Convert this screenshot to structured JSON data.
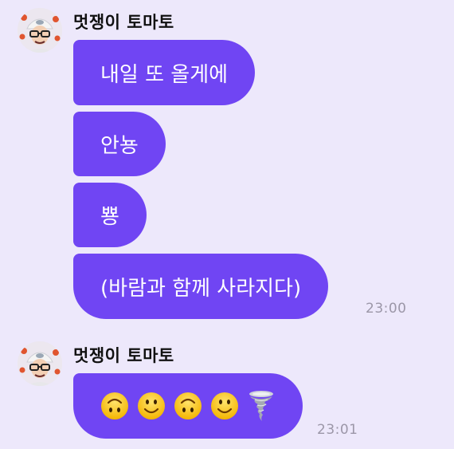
{
  "groups": [
    {
      "sender": "멋쟁이 토마토",
      "messages": [
        "내일 또 올게에",
        "안뇽",
        "뿅",
        "(바람과 함께 사라지다)"
      ],
      "time": "23:00"
    },
    {
      "sender": "멋쟁이 토마토",
      "emojis": [
        "upside-down-face",
        "slightly-smiling-face",
        "upside-down-face",
        "slightly-smiling-face",
        "tornado"
      ],
      "time": "23:01"
    }
  ],
  "colors": {
    "background": "#ede8fb",
    "bubble": "#7045f3",
    "bubble_text": "#ffffff",
    "sender_text": "#111111",
    "time_text": "#9c97a8"
  }
}
